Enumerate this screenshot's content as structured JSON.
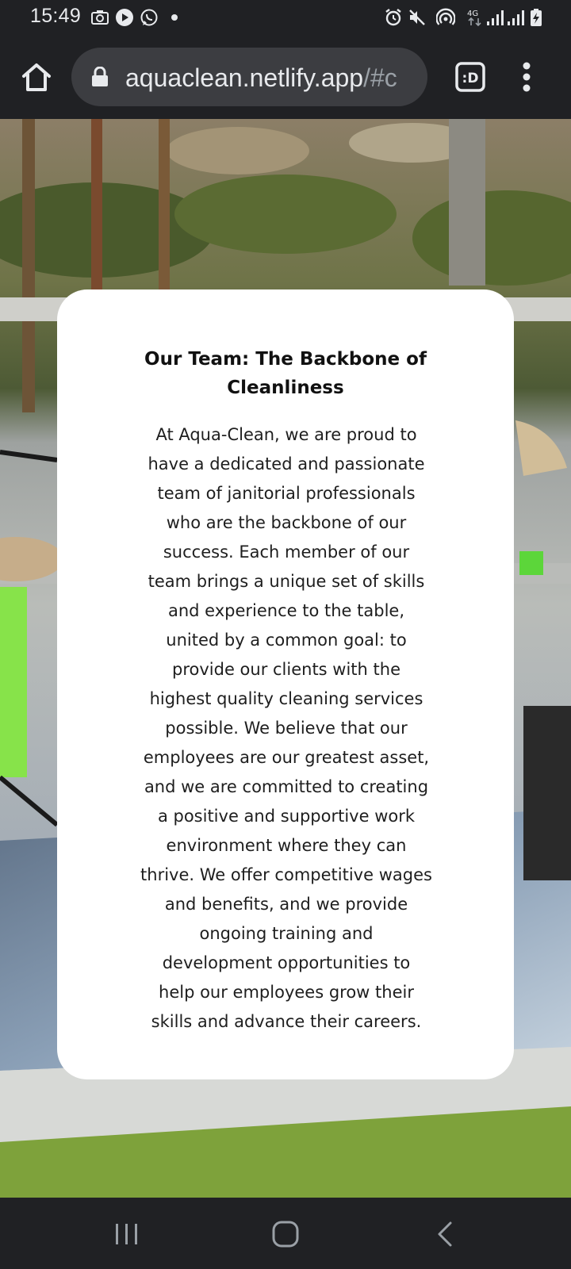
{
  "status_bar": {
    "time": "15:49",
    "icons_left": [
      "camera-icon",
      "play-icon",
      "whatsapp-icon",
      "notification-dot-icon"
    ],
    "icons_right": [
      "alarm-icon",
      "mute-icon",
      "hotspot-icon",
      "4g-icon",
      "signal-icon",
      "signal-icon",
      "battery-charging-icon"
    ],
    "network_label": "4G"
  },
  "browser": {
    "url_domain": "aquaclean.netlify.app",
    "url_path": "/#c",
    "tabs_label": ":D"
  },
  "card": {
    "title_lines": [
      "Our Team: The Backbone of",
      "Cleanliness"
    ],
    "body_lines": [
      "At Aqua-Clean, we are proud to",
      "have a dedicated and passionate",
      "team of janitorial professionals",
      "who are the backbone of our",
      "success. Each member of our",
      "team brings a unique set of skills",
      "and experience to the table,",
      "united by a common goal: to",
      "provide our clients with the",
      "highest quality cleaning services",
      "possible. We believe that our",
      "employees are our greatest asset,",
      "and we are committed to creating",
      "a positive and supportive work",
      "environment where they can",
      "thrive. We offer competitive wages",
      "and benefits, and we provide",
      "ongoing training and",
      "development opportunities to",
      "help our employees grow their",
      "skills and advance their careers."
    ]
  },
  "colors": {
    "chrome_bg": "#202124",
    "url_pill_bg": "#3c3d41",
    "card_bg": "#ffffff",
    "text_primary": "#e8eaed"
  },
  "nav_bar": {
    "buttons": [
      "recent-apps-icon",
      "home-icon",
      "back-icon"
    ]
  }
}
